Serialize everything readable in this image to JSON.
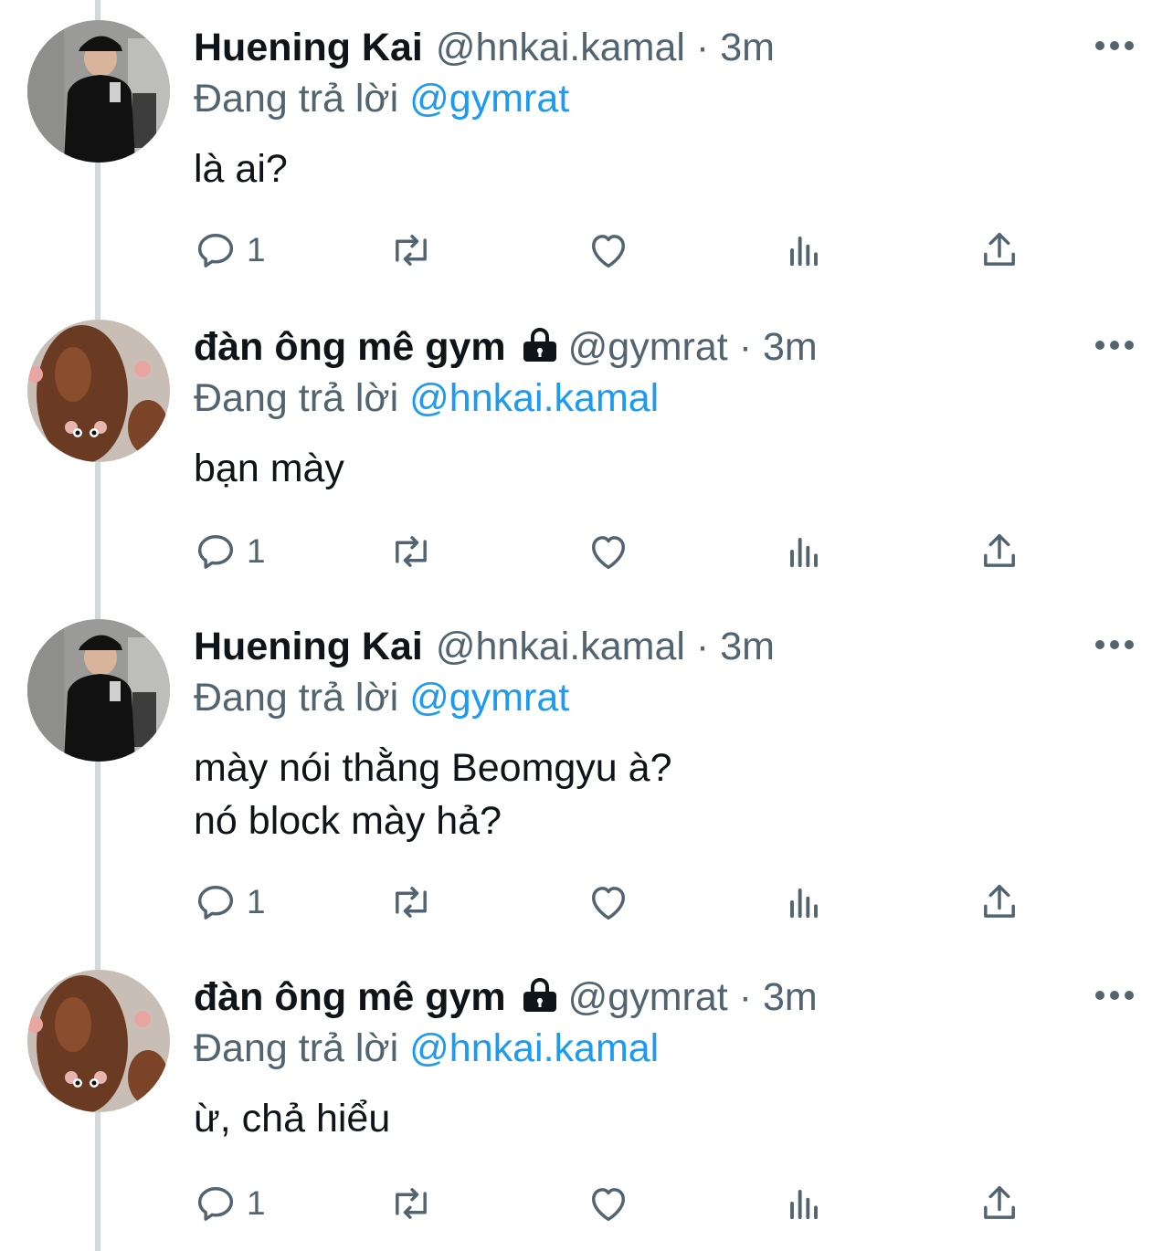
{
  "reply_prefix": "Đang trả lời",
  "tweets": [
    {
      "name": "Huening Kai",
      "handle": "@hnkai.kamal",
      "separator": "·",
      "time": "3m",
      "reply_to": "@gymrat",
      "text": "là ai?",
      "reply_count": "1",
      "locked": false
    },
    {
      "name": "đàn ông mê gym",
      "handle": "@gymrat",
      "separator": "·",
      "time": "3m",
      "reply_to": "@hnkai.kamal",
      "text": "bạn mày",
      "reply_count": "1",
      "locked": true
    },
    {
      "name": "Huening Kai",
      "handle": "@hnkai.kamal",
      "separator": "·",
      "time": "3m",
      "reply_to": "@gymrat",
      "text": "mày nói thằng Beomgyu à?\nnó block mày hả?",
      "reply_count": "1",
      "locked": false
    },
    {
      "name": "đàn ông mê gym",
      "handle": "@gymrat",
      "separator": "·",
      "time": "3m",
      "reply_to": "@hnkai.kamal",
      "text": "ừ, chả hiểu",
      "reply_count": "1",
      "locked": true
    }
  ],
  "colors": {
    "primary_text": "#0f1419",
    "secondary_text": "#536471",
    "mention": "#1d9bf0",
    "thread_line": "#cfd9de"
  },
  "icons": [
    "reply-icon",
    "retweet-icon",
    "like-icon",
    "views-icon",
    "share-icon",
    "more-icon",
    "lock-icon"
  ]
}
